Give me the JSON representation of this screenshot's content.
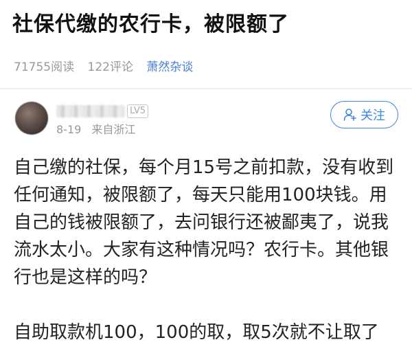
{
  "article": {
    "title": "社保代缴的农行卡，被限额了",
    "reads": "71755阅读",
    "comments": "122评论",
    "column": "萧然杂谈"
  },
  "author": {
    "level": "LV5",
    "date": "8-19",
    "location": "来自浙江",
    "follow_label": "关注"
  },
  "post": {
    "paragraphs": [
      "自己缴的社保，每个月15号之前扣款，没有收到任何通知，被限额了，每天只能用100块钱。用自己的钱被限额了，去问银行还被鄙夷了，说我流水太小。大家有这种情况吗？农行卡。其他银行也是这样的吗？",
      "自助取款机100，100的取，取5次就不让取了"
    ]
  },
  "colors": {
    "accent": "#3a86e0",
    "link": "#4a7fd4",
    "muted": "#999999"
  }
}
